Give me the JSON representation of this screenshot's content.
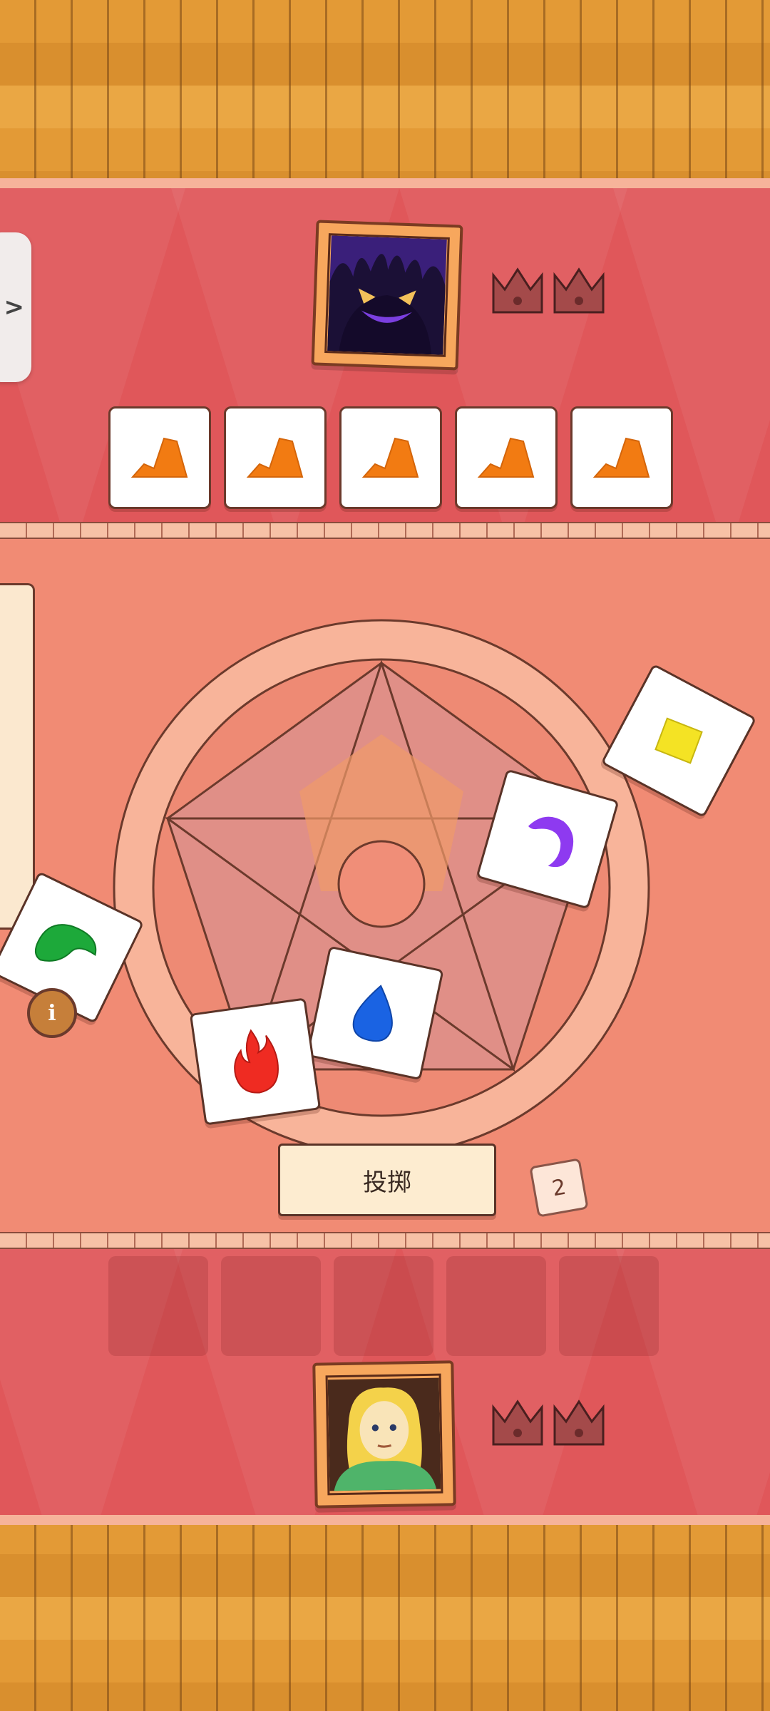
{
  "game": {
    "opponent": {
      "name": "shadow-demon",
      "crowns": 2
    },
    "player": {
      "name": "player-avatar",
      "crowns": 2
    },
    "opponent_dice": [
      "earth",
      "earth",
      "earth",
      "earth",
      "earth"
    ],
    "player_slots": 5,
    "board_dice": [
      "lightning",
      "moon",
      "air",
      "water",
      "fire"
    ],
    "roll_button_label": "投掷",
    "rolls_left": "2",
    "side_tab_label": ">",
    "info_label": "i"
  },
  "colors": {
    "band": "#e0575a",
    "board": "#f18b74",
    "earth": "#f27b12",
    "lightning": "#f4e324",
    "moon": "#8e3af0",
    "air": "#1da93a",
    "water": "#1a63e3",
    "fire": "#ef2b22"
  }
}
